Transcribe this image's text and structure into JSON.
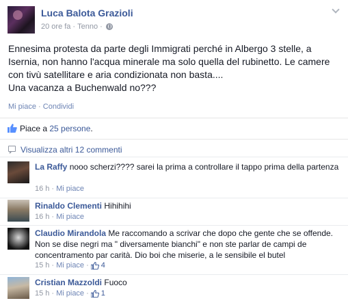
{
  "post": {
    "author": "Luca Balota Grazioli",
    "time": "20 ore fa",
    "location": "Tenno",
    "separator": "·",
    "text_lines": [
      "Ennesima protesta da parte degli Immigrati perché in Albergo 3 stelle, a",
      "Isernia, non hanno l'acqua minerale ma solo quella del rubinetto. Le camere",
      "con tivù satellitare e aria condizionata non basta....",
      "Una vacanza a Buchenwald no???"
    ],
    "like_label": "Mi piace",
    "share_label": "Condividi"
  },
  "likes": {
    "prefix": "Piace a ",
    "count_link": "25 persone",
    "suffix": "."
  },
  "more_comments": "Visualizza altri 12 commenti",
  "comments": [
    {
      "name": "La Raffy",
      "text": "nooo scherzi???? sarei la prima a controllare il tappo prima della partenza",
      "time": "16 h",
      "like_label": "Mi piace",
      "likes": ""
    },
    {
      "name": "Rinaldo Clementi",
      "text": "Hihihihi",
      "time": "16 h",
      "like_label": "Mi piace",
      "likes": ""
    },
    {
      "name": "Claudio Mirandola",
      "text": "Me raccomando a scrivar che dopo che gente che se offende. Non se dise negri ma \" diversamente bianchi\" e non ste parlar de campi de concentramento par carità. Dio boi che miserie, a le sensibile el butel",
      "time": "15 h",
      "like_label": "Mi piace",
      "likes": "4"
    },
    {
      "name": "Cristian Mazzoldi",
      "text": "Fuoco",
      "time": "15 h",
      "like_label": "Mi piace",
      "likes": "1"
    }
  ],
  "colors": {
    "link": "#3b5998",
    "meta": "#9197a3",
    "text": "#141823"
  }
}
